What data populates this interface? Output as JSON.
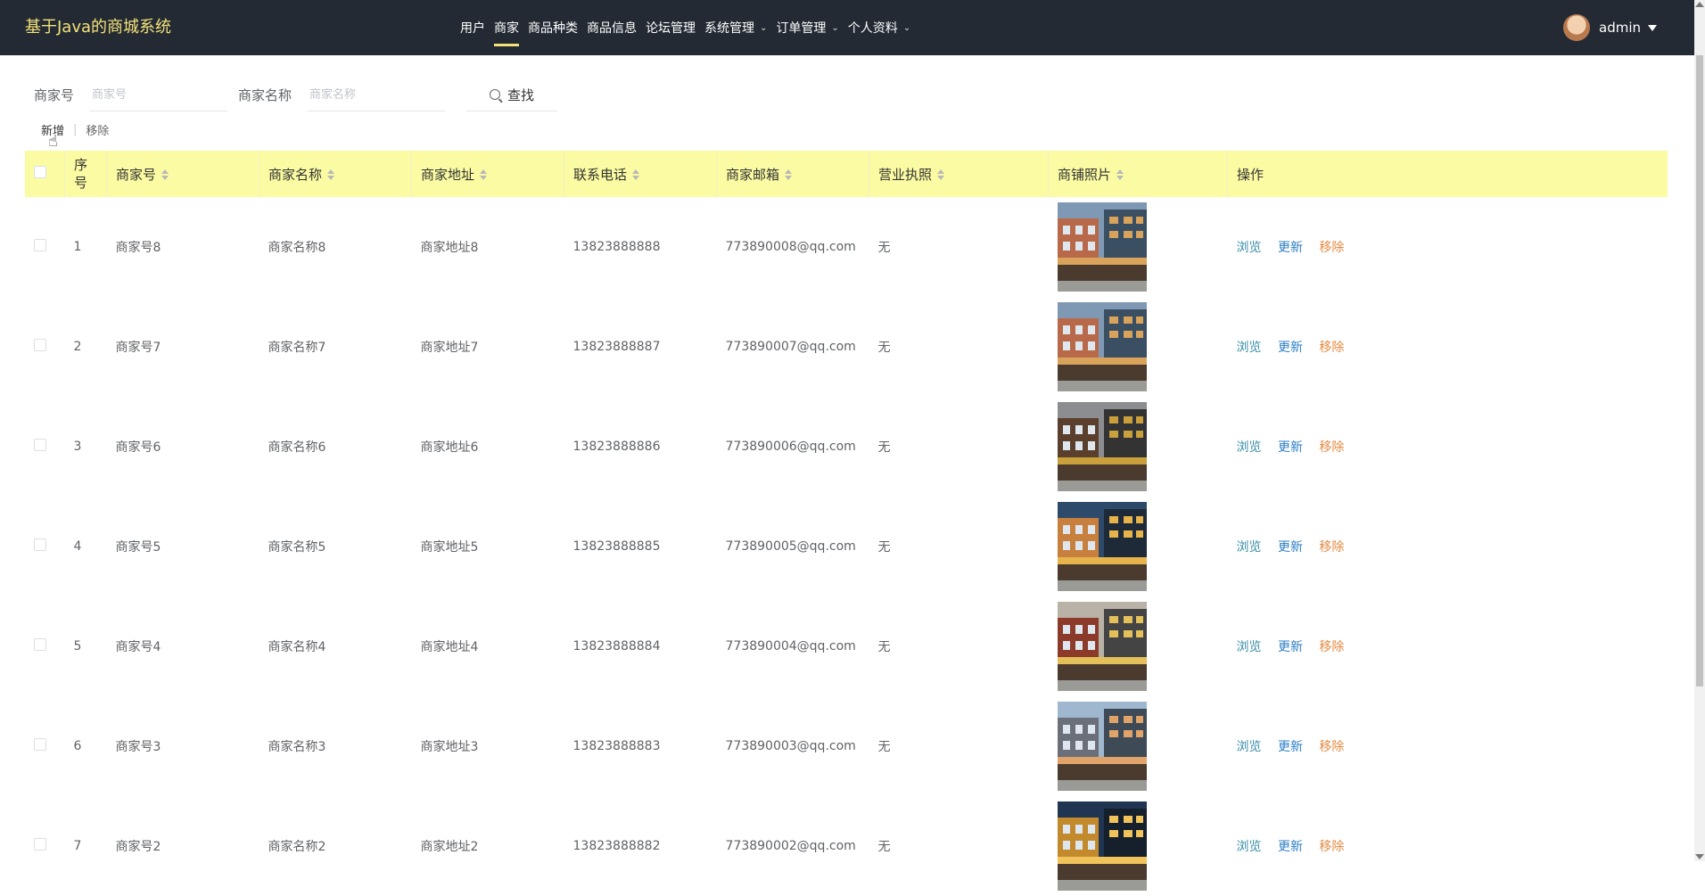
{
  "app": {
    "title": "基于Java的商城系统"
  },
  "nav": {
    "items": [
      {
        "label": "用户",
        "has_menu": false,
        "active": false
      },
      {
        "label": "商家",
        "has_menu": false,
        "active": true
      },
      {
        "label": "商品种类",
        "has_menu": false,
        "active": false
      },
      {
        "label": "商品信息",
        "has_menu": false,
        "active": false
      },
      {
        "label": "论坛管理",
        "has_menu": false,
        "active": false
      },
      {
        "label": "系统管理",
        "has_menu": true,
        "active": false
      },
      {
        "label": "订单管理",
        "has_menu": true,
        "active": false
      },
      {
        "label": "个人资料",
        "has_menu": true,
        "active": false
      }
    ]
  },
  "user": {
    "name": "admin"
  },
  "search": {
    "merchant_no_label": "商家号",
    "merchant_no_placeholder": "商家号",
    "merchant_name_label": "商家名称",
    "merchant_name_placeholder": "商家名称",
    "button": "查找"
  },
  "actions": {
    "add": "新增",
    "delete": "移除"
  },
  "table": {
    "headers": {
      "index": "序号",
      "merchant_no": "商家号",
      "merchant_name": "商家名称",
      "address": "商家地址",
      "phone": "联系电话",
      "email": "商家邮箱",
      "license": "营业执照",
      "photo": "商铺照片",
      "ops": "操作"
    },
    "ops": {
      "view": "浏览",
      "edit": "更新",
      "delete": "移除"
    },
    "rows": [
      {
        "index": "1",
        "merchant_no": "商家号8",
        "merchant_name": "商家名称8",
        "address": "商家地址8",
        "phone": "13823888888",
        "email": "773890008@qq.com",
        "license": "无"
      },
      {
        "index": "2",
        "merchant_no": "商家号7",
        "merchant_name": "商家名称7",
        "address": "商家地址7",
        "phone": "13823888887",
        "email": "773890007@qq.com",
        "license": "无"
      },
      {
        "index": "3",
        "merchant_no": "商家号6",
        "merchant_name": "商家名称6",
        "address": "商家地址6",
        "phone": "13823888886",
        "email": "773890006@qq.com",
        "license": "无"
      },
      {
        "index": "4",
        "merchant_no": "商家号5",
        "merchant_name": "商家名称5",
        "address": "商家地址5",
        "phone": "13823888885",
        "email": "773890005@qq.com",
        "license": "无"
      },
      {
        "index": "5",
        "merchant_no": "商家号4",
        "merchant_name": "商家名称4",
        "address": "商家地址4",
        "phone": "13823888884",
        "email": "773890004@qq.com",
        "license": "无"
      },
      {
        "index": "6",
        "merchant_no": "商家号3",
        "merchant_name": "商家名称3",
        "address": "商家地址3",
        "phone": "13823888883",
        "email": "773890003@qq.com",
        "license": "无"
      },
      {
        "index": "7",
        "merchant_no": "商家号2",
        "merchant_name": "商家名称2",
        "address": "商家地址2",
        "phone": "13823888882",
        "email": "773890002@qq.com",
        "license": "无"
      }
    ]
  },
  "colors": {
    "topbar": "#232a33",
    "brand": "#f3e27a",
    "header_row": "#fbfba3",
    "view": "#3a8ea8",
    "edit": "#2c7ec6",
    "delete": "#e6893f"
  }
}
